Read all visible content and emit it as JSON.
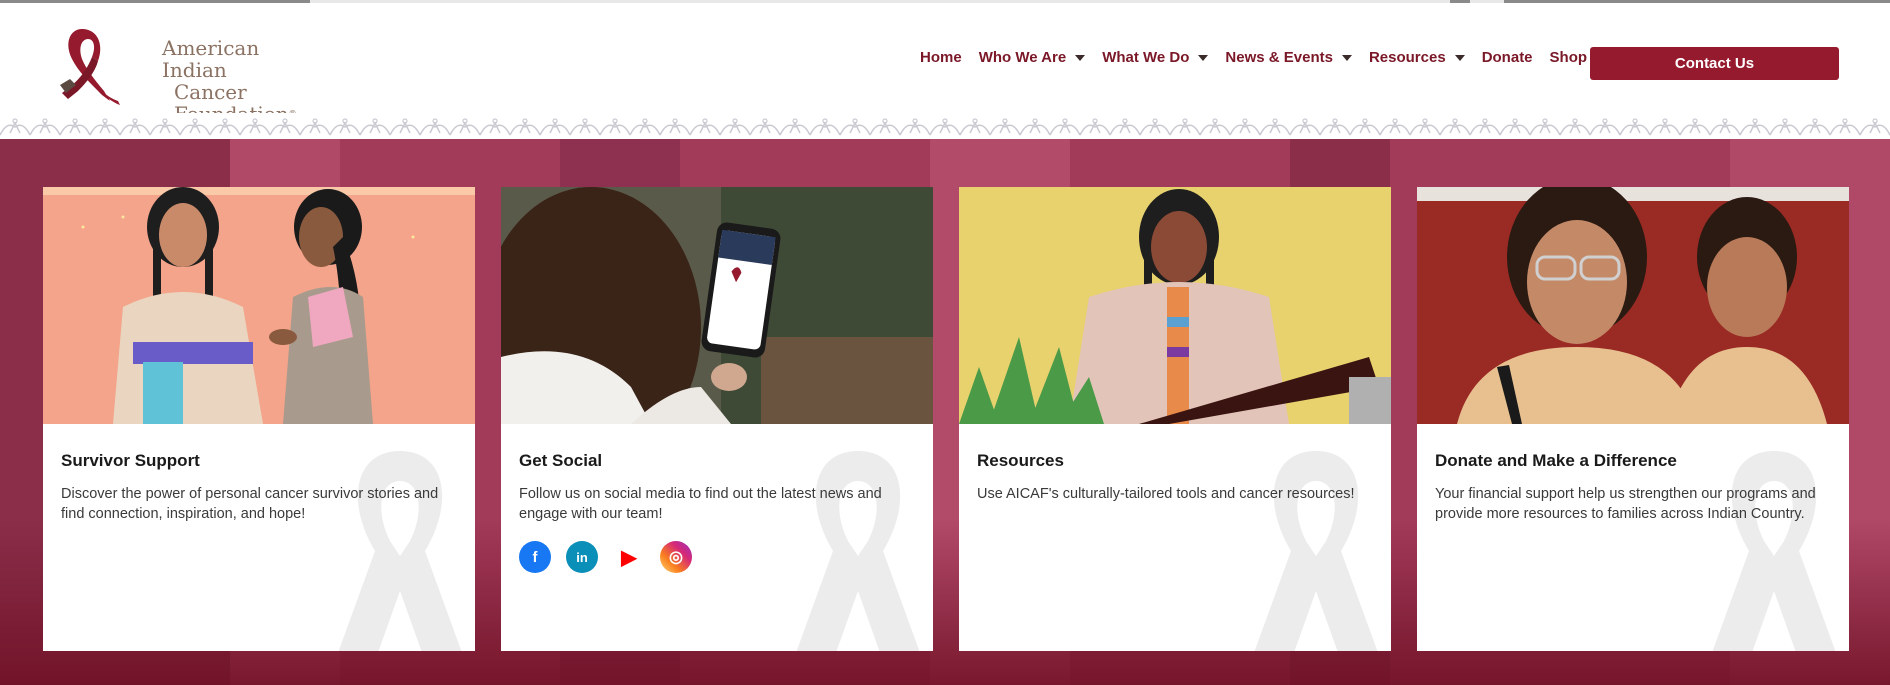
{
  "header": {
    "logo": {
      "line1": "American Indian",
      "line2": "Cancer Foundation",
      "reg": "®"
    },
    "nav": [
      {
        "label": "Home",
        "dropdown": false
      },
      {
        "label": "Who We Are",
        "dropdown": true
      },
      {
        "label": "What We Do",
        "dropdown": true
      },
      {
        "label": "News & Events",
        "dropdown": true
      },
      {
        "label": "Resources",
        "dropdown": true
      },
      {
        "label": "Donate",
        "dropdown": false
      },
      {
        "label": "Shop",
        "dropdown": false
      }
    ],
    "contact_label": "Contact Us"
  },
  "cards": [
    {
      "title": "Survivor Support",
      "text": "Discover the power of personal cancer survivor stories and find connection, inspiration, and hope!"
    },
    {
      "title": "Get Social",
      "text": "Follow us on social media to find out the latest news and engage with our team!"
    },
    {
      "title": "Resources",
      "text": "Use AICAF's culturally-tailored tools and cancer resources!"
    },
    {
      "title": "Donate and Make a Difference",
      "text": "Your financial support help us strengthen our programs and provide more resources to families across Indian Country."
    }
  ],
  "socials": [
    {
      "icon": "facebook-icon",
      "glyph": "f",
      "color": "#1877f2"
    },
    {
      "icon": "linkedin-icon",
      "glyph": "in",
      "color": "#0a8fb8"
    },
    {
      "icon": "youtube-icon",
      "glyph": "▶",
      "color": "#ff0000"
    },
    {
      "icon": "instagram-icon",
      "glyph": "◎",
      "color": "#d62976"
    }
  ],
  "colors": {
    "accent": "#951a2d",
    "nav_text": "#7a1828",
    "band": "#a23a5a"
  }
}
